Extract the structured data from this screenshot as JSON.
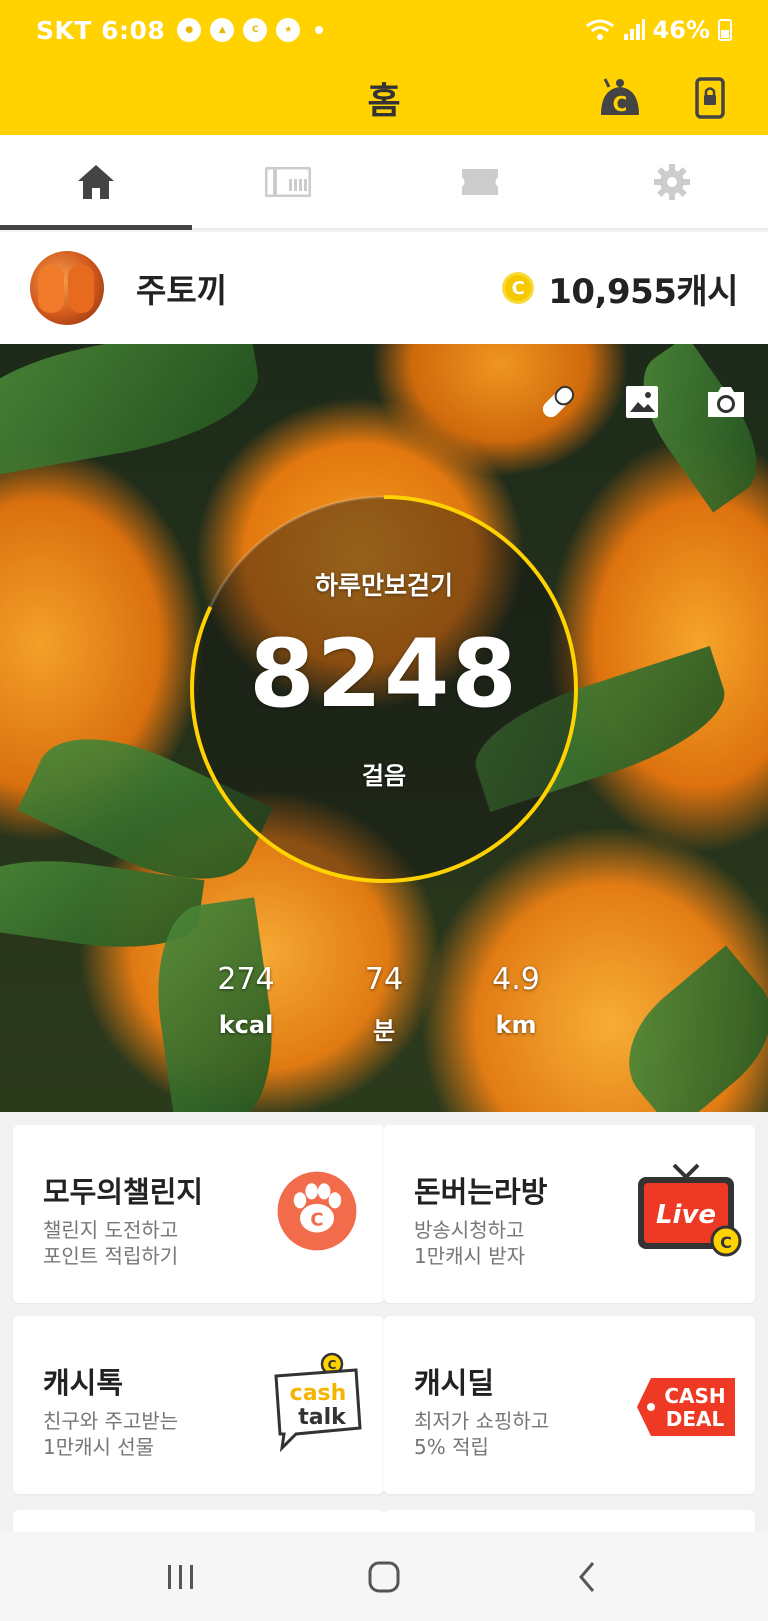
{
  "status_bar": {
    "carrier_time": "SKT 6:08",
    "battery": "46%",
    "icons": [
      "talk-icon",
      "cashwalk-icon",
      "c-icon",
      "kb-icon"
    ]
  },
  "app_bar": {
    "title": "홈"
  },
  "tabs": [
    {
      "name": "home-icon",
      "active": true
    },
    {
      "name": "gift-icon",
      "active": false
    },
    {
      "name": "ticket-icon",
      "active": false
    },
    {
      "name": "gear-icon",
      "active": false
    }
  ],
  "profile": {
    "name": "주토끼",
    "cash": "10,955캐시"
  },
  "pedometer": {
    "title": "하루만보걷기",
    "steps": "8248",
    "unit": "걸음",
    "progress": 0.82,
    "stats": [
      {
        "value": "274",
        "unit": "kcal"
      },
      {
        "value": "74",
        "unit": "분"
      },
      {
        "value": "4.9",
        "unit": "km"
      }
    ]
  },
  "cards": [
    {
      "title": "모두의챌린지",
      "line1": "챌린지 도전하고",
      "line2": "포인트 적립하기",
      "icon": "paw-coin-icon"
    },
    {
      "title": "돈버는라방",
      "line1": "방송시청하고",
      "line2": "1만캐시 받자",
      "icon": "live-tv-icon",
      "icon_text": "Live"
    },
    {
      "title": "캐시톡",
      "line1": "친구와 주고받는",
      "line2": "1만캐시 선물",
      "icon": "cash-talk-icon",
      "icon_text_1": "cash",
      "icon_text_2": "talk"
    },
    {
      "title": "캐시딜",
      "line1": "최저가 쇼핑하고",
      "line2": "5% 적립",
      "icon": "cash-deal-icon",
      "icon_text_1": "CASH",
      "icon_text_2": "DEAL"
    }
  ],
  "colors": {
    "brand_yellow": "#ffd200",
    "ring": "#ffd200",
    "deal_red": "#ee3a24"
  }
}
